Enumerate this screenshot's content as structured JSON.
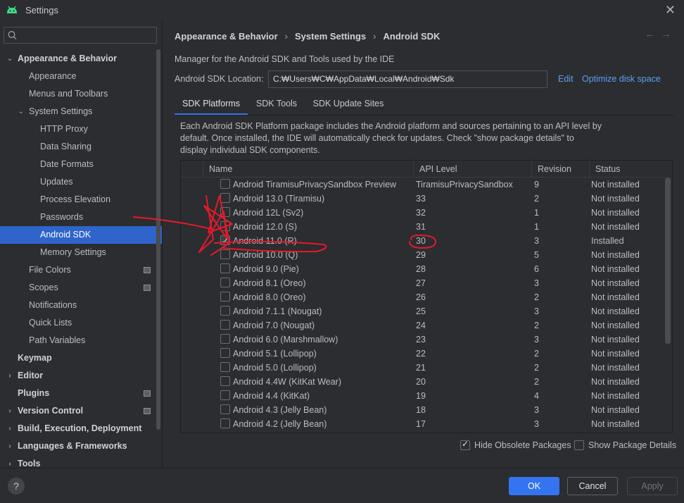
{
  "window": {
    "title": "Settings"
  },
  "search": {
    "placeholder": "Q-"
  },
  "sidebar": {
    "items": [
      {
        "label": "Appearance & Behavior"
      },
      {
        "label": "Appearance"
      },
      {
        "label": "Menus and Toolbars"
      },
      {
        "label": "System Settings"
      },
      {
        "label": "HTTP Proxy"
      },
      {
        "label": "Data Sharing"
      },
      {
        "label": "Date Formats"
      },
      {
        "label": "Updates"
      },
      {
        "label": "Process Elevation"
      },
      {
        "label": "Passwords"
      },
      {
        "label": "Android SDK"
      },
      {
        "label": "Memory Settings"
      },
      {
        "label": "File Colors"
      },
      {
        "label": "Scopes"
      },
      {
        "label": "Notifications"
      },
      {
        "label": "Quick Lists"
      },
      {
        "label": "Path Variables"
      },
      {
        "label": "Keymap"
      },
      {
        "label": "Editor"
      },
      {
        "label": "Plugins"
      },
      {
        "label": "Version Control"
      },
      {
        "label": "Build, Execution, Deployment"
      },
      {
        "label": "Languages & Frameworks"
      },
      {
        "label": "Tools"
      }
    ]
  },
  "breadcrumb": {
    "items": [
      "Appearance & Behavior",
      "System Settings",
      "Android SDK"
    ],
    "separator": "›"
  },
  "nav": {
    "back": "←",
    "forward": "→"
  },
  "main": {
    "description": "Manager for the Android SDK and Tools used by the IDE",
    "location_label": "Android SDK Location:",
    "location_value": "C:₩Users₩C₩AppData₩Local₩Android₩Sdk",
    "edit_link": "Edit",
    "optimize_link": "Optimize disk space",
    "tabs": [
      {
        "label": "SDK Platforms"
      },
      {
        "label": "SDK Tools"
      },
      {
        "label": "SDK Update Sites"
      }
    ],
    "platform_description": "Each Android SDK Platform package includes the Android platform and sources pertaining to an API level by default. Once installed, the IDE will automatically check for updates. Check \"show package details\" to display individual SDK components."
  },
  "table": {
    "columns": [
      "Name",
      "API Level",
      "Revision",
      "Status"
    ],
    "rows": [
      {
        "name": "Android TiramisuPrivacySandbox Preview",
        "api": "TiramisuPrivacySandbox",
        "rev": "9",
        "status": "Not installed",
        "checked": false
      },
      {
        "name": "Android 13.0 (Tiramisu)",
        "api": "33",
        "rev": "2",
        "status": "Not installed",
        "checked": false
      },
      {
        "name": "Android 12L (Sv2)",
        "api": "32",
        "rev": "1",
        "status": "Not installed",
        "checked": false
      },
      {
        "name": "Android 12.0 (S)",
        "api": "31",
        "rev": "1",
        "status": "Not installed",
        "checked": false
      },
      {
        "name": "Android 11.0 (R)",
        "api": "30",
        "rev": "3",
        "status": "Installed",
        "checked": true
      },
      {
        "name": "Android 10.0 (Q)",
        "api": "29",
        "rev": "5",
        "status": "Not installed",
        "checked": false
      },
      {
        "name": "Android 9.0 (Pie)",
        "api": "28",
        "rev": "6",
        "status": "Not installed",
        "checked": false
      },
      {
        "name": "Android 8.1 (Oreo)",
        "api": "27",
        "rev": "3",
        "status": "Not installed",
        "checked": false
      },
      {
        "name": "Android 8.0 (Oreo)",
        "api": "26",
        "rev": "2",
        "status": "Not installed",
        "checked": false
      },
      {
        "name": "Android 7.1.1 (Nougat)",
        "api": "25",
        "rev": "3",
        "status": "Not installed",
        "checked": false
      },
      {
        "name": "Android 7.0 (Nougat)",
        "api": "24",
        "rev": "2",
        "status": "Not installed",
        "checked": false
      },
      {
        "name": "Android 6.0 (Marshmallow)",
        "api": "23",
        "rev": "3",
        "status": "Not installed",
        "checked": false
      },
      {
        "name": "Android 5.1 (Lollipop)",
        "api": "22",
        "rev": "2",
        "status": "Not installed",
        "checked": false
      },
      {
        "name": "Android 5.0 (Lollipop)",
        "api": "21",
        "rev": "2",
        "status": "Not installed",
        "checked": false
      },
      {
        "name": "Android 4.4W (KitKat Wear)",
        "api": "20",
        "rev": "2",
        "status": "Not installed",
        "checked": false
      },
      {
        "name": "Android 4.4 (KitKat)",
        "api": "19",
        "rev": "4",
        "status": "Not installed",
        "checked": false
      },
      {
        "name": "Android 4.3 (Jelly Bean)",
        "api": "18",
        "rev": "3",
        "status": "Not installed",
        "checked": false
      },
      {
        "name": "Android 4.2 (Jelly Bean)",
        "api": "17",
        "rev": "3",
        "status": "Not installed",
        "checked": false
      }
    ]
  },
  "options": {
    "hide_obsolete": "Hide Obsolete Packages",
    "show_details": "Show Package Details"
  },
  "footer": {
    "help": "?",
    "ok": "OK",
    "cancel": "Cancel",
    "apply": "Apply"
  },
  "colors": {
    "accent": "#3574f0",
    "selection": "#2f65ca",
    "link": "#5a9ff5",
    "annotation": "#e8182b"
  }
}
